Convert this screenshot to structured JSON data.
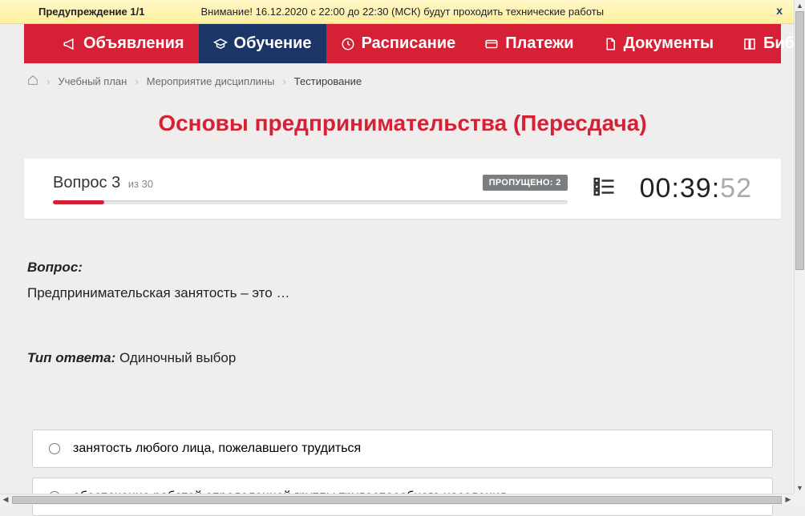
{
  "warning": {
    "title": "Предупреждение 1/1",
    "message": "Внимание! 16.12.2020 с 22:00 до 22:30 (МСК) будут проходить технические работы",
    "close": "x"
  },
  "nav": {
    "announcements": "Объявления",
    "education": "Обучение",
    "schedule": "Расписание",
    "payments": "Платежи",
    "documents": "Документы",
    "library": "Библиотека"
  },
  "breadcrumbs": {
    "plan": "Учебный план",
    "event": "Мероприятие дисциплины",
    "current": "Тестирование"
  },
  "page_title": "Основы предпринимательства (Пересдача)",
  "question_status": {
    "label": "Вопрос",
    "number": "3",
    "of_prefix": "из",
    "total": "30",
    "skipped_label": "ПРОПУЩЕНО:",
    "skipped_count": "2",
    "progress_percent": 10
  },
  "timer": {
    "hours": "00",
    "minutes": "39",
    "seconds": "52"
  },
  "question": {
    "label": "Вопрос:",
    "text": "Предпринимательская занятость – это …",
    "answer_type_label": "Тип ответа:",
    "answer_type_value": "Одиночный выбор"
  },
  "answers": [
    "занятость любого лица, пожелавшего трудиться",
    "обеспечение работой определенной группы трудоспособного населения"
  ]
}
